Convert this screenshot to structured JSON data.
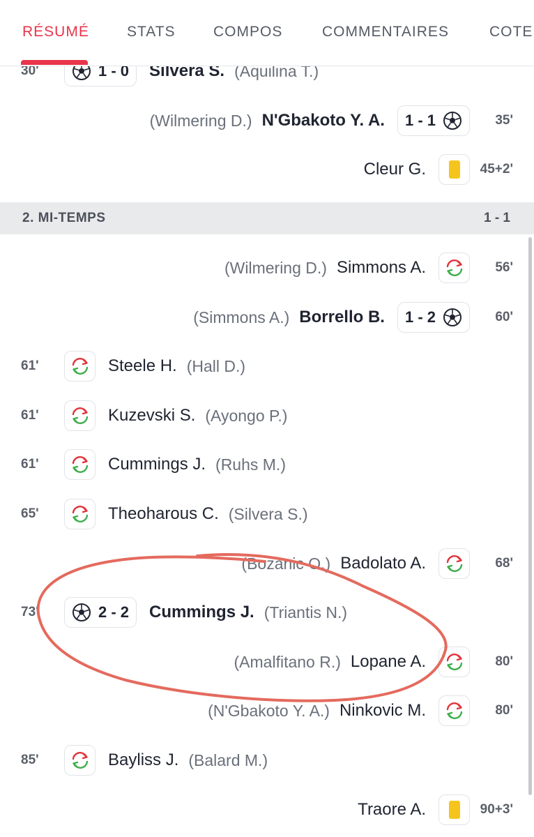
{
  "tabs": [
    "RÉSUMÉ",
    "STATS",
    "COMPOS",
    "COMMENTAIRES",
    "COTE"
  ],
  "first_half": [
    {
      "minute": "30'",
      "side": "left",
      "type": "goal",
      "score": "1 - 0",
      "player": "Silvera S.",
      "assist": "(Aquilina T.)"
    },
    {
      "minute": "35'",
      "side": "right",
      "type": "goal",
      "score": "1 - 1",
      "player": "N'Gbakoto Y. A.",
      "assist": "(Wilmering D.)"
    },
    {
      "minute": "45+2'",
      "side": "right",
      "type": "yellow-card",
      "player": "Cleur G."
    }
  ],
  "second_half_header": {
    "title": "2. MI-TEMPS",
    "score": "1 - 1"
  },
  "second_half": [
    {
      "minute": "56'",
      "side": "right",
      "type": "substitution",
      "player": "Simmons A.",
      "assist": "(Wilmering D.)"
    },
    {
      "minute": "60'",
      "side": "right",
      "type": "goal",
      "score": "1 - 2",
      "player": "Borrello B.",
      "assist": "(Simmons A.)"
    },
    {
      "minute": "61'",
      "side": "left",
      "type": "substitution",
      "player": "Steele H.",
      "assist": "(Hall D.)"
    },
    {
      "minute": "61'",
      "side": "left",
      "type": "substitution",
      "player": "Kuzevski S.",
      "assist": "(Ayongo P.)"
    },
    {
      "minute": "61'",
      "side": "left",
      "type": "substitution",
      "player": "Cummings J.",
      "assist": "(Ruhs M.)"
    },
    {
      "minute": "65'",
      "side": "left",
      "type": "substitution",
      "player": "Theoharous C.",
      "assist": "(Silvera S.)"
    },
    {
      "minute": "68'",
      "side": "right",
      "type": "substitution",
      "player": "Badolato A.",
      "assist": "(Bozanic O.)"
    },
    {
      "minute": "73'",
      "side": "left",
      "type": "goal",
      "score": "2 - 2",
      "player": "Cummings J.",
      "assist": "(Triantis N.)"
    },
    {
      "minute": "80'",
      "side": "right",
      "type": "substitution",
      "player": "Lopane A.",
      "assist": "(Amalfitano R.)"
    },
    {
      "minute": "80'",
      "side": "right",
      "type": "substitution",
      "player": "Ninkovic M.",
      "assist": "(N'Gbakoto Y. A.)"
    },
    {
      "minute": "85'",
      "side": "left",
      "type": "substitution",
      "player": "Bayliss J.",
      "assist": "(Balard M.)"
    },
    {
      "minute": "90+3'",
      "side": "right",
      "type": "yellow-card",
      "player": "Traore A."
    }
  ],
  "colors": {
    "accent": "#e8344a",
    "yellow_card": "#f5c51d",
    "sub_in": "#3fae4a",
    "sub_out": "#e0343a",
    "annotation": "#e46a5e"
  }
}
